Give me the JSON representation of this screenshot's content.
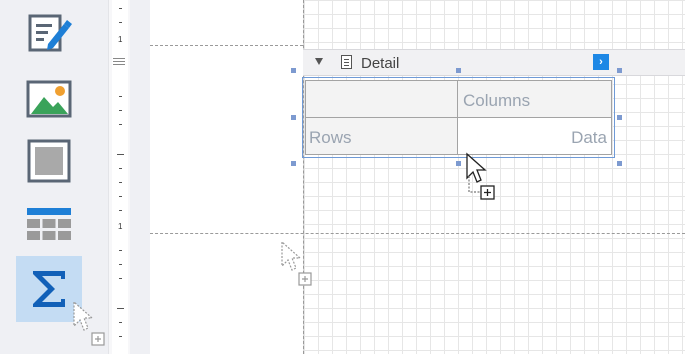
{
  "toolbox": {
    "items": [
      {
        "name": "label-tool",
        "icon": "edit-label-icon"
      },
      {
        "name": "picture-tool",
        "icon": "picture-icon"
      },
      {
        "name": "panel-tool",
        "icon": "panel-icon"
      },
      {
        "name": "table-tool",
        "icon": "table-icon"
      },
      {
        "name": "pivot-grid-tool",
        "icon": "sigma-icon",
        "selected": true
      }
    ]
  },
  "ruler": {
    "numbers": [
      "1",
      "1"
    ]
  },
  "band": {
    "label": "Detail",
    "smart_tag": "›"
  },
  "pivot_grid": {
    "columns_label": "Columns",
    "rows_label": "Rows",
    "data_label": "Data"
  },
  "colors": {
    "accent": "#1e88e5",
    "selection": "#7d9ad0",
    "toolbox_bg": "#eff0f4",
    "selected_tool_bg": "#c4dcf3"
  }
}
